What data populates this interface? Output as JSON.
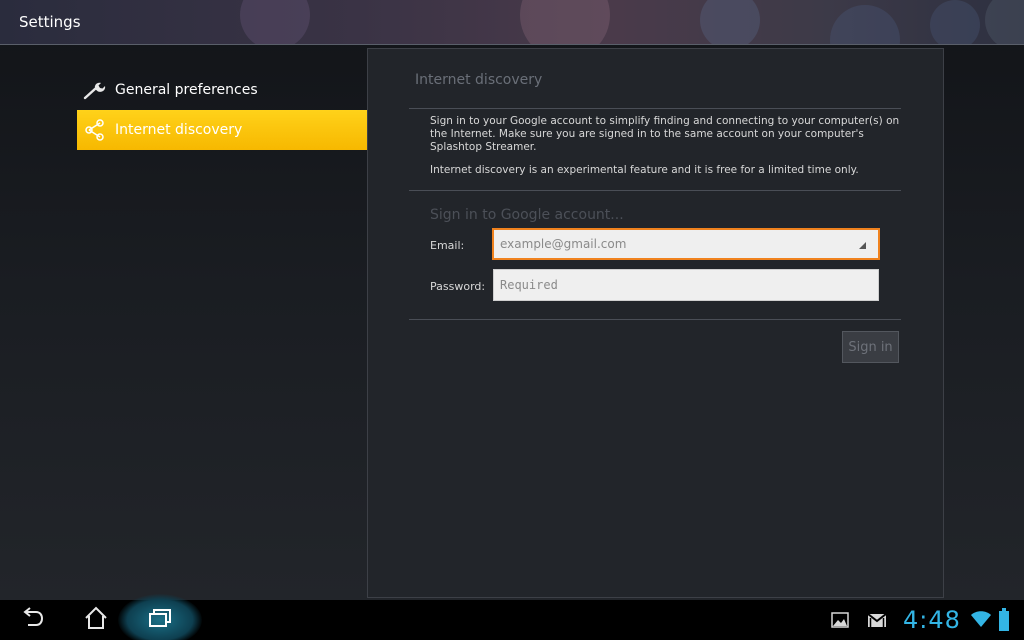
{
  "action_bar": {
    "title": "Settings"
  },
  "nav": {
    "items": [
      {
        "label": "General preferences",
        "icon": "wrench-icon",
        "selected": false
      },
      {
        "label": "Internet discovery",
        "icon": "share-icon",
        "selected": true
      }
    ]
  },
  "panel": {
    "header": "Internet discovery",
    "description_1": "Sign in to your Google account to simplify finding and connecting to your computer(s) on the Internet. Make sure you are signed in to the same account on your computer's Splashtop Streamer.",
    "description_2": "Internet discovery is an experimental feature and it is free for a limited time only.",
    "subhead": "Sign in to Google account...",
    "email_label": "Email:",
    "email_value": "example@gmail.com",
    "password_label": "Password:",
    "password_placeholder": "Required",
    "signin_label": "Sign in"
  },
  "system_bar": {
    "clock": "4:48",
    "icons": [
      "back-icon",
      "home-icon",
      "recent-apps-icon",
      "gallery-notification-icon",
      "gmail-notification-icon",
      "wifi-icon",
      "battery-icon"
    ]
  },
  "colors": {
    "accent": "#ffc800",
    "focus_border": "#f0821e",
    "clock": "#33b5e5"
  }
}
